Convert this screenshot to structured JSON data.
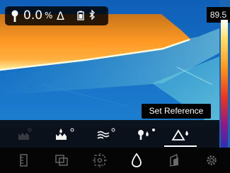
{
  "status": {
    "emissivity_value": "0.0",
    "emissivity_unit": "%",
    "delta_symbol": "Δ"
  },
  "scale": {
    "max": "89.5"
  },
  "tooltip": {
    "text": "Set Reference"
  },
  "submenu": {
    "items": [
      {
        "icon": "humidity-disabled-icon",
        "active": false
      },
      {
        "icon": "dew-point-icon",
        "active": false
      },
      {
        "icon": "air-temperature-icon",
        "active": false
      },
      {
        "icon": "probe-drop-icon",
        "active": false
      },
      {
        "icon": "delta-reference-icon",
        "active": true
      }
    ]
  },
  "toolbar": {
    "items": [
      {
        "icon": "measure-icon"
      },
      {
        "icon": "image-blend-icon"
      },
      {
        "icon": "spot-target-icon"
      },
      {
        "icon": "moisture-drop-icon"
      },
      {
        "icon": "palette-icon"
      },
      {
        "icon": "settings-gear-icon"
      }
    ]
  },
  "colors": {
    "accent": "#ffffff",
    "thermal_hot": "#ff9a1a",
    "thermal_cold": "#1a66b5"
  }
}
